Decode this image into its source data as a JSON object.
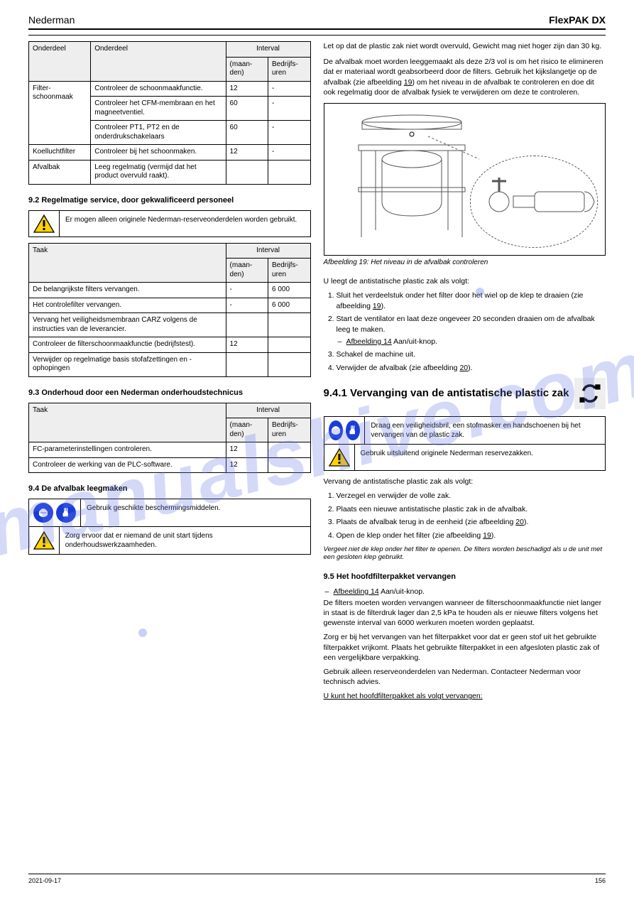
{
  "header": {
    "left": "Nederman",
    "right": "FlexPAK DX"
  },
  "tables": {
    "t1": {
      "head": [
        "Onderdeel",
        "Onderdeel",
        "Interval",
        "IntervalH"
      ],
      "subhead_a": "(maan-den)",
      "subhead_b": "Bedrijfs-uren",
      "rows": [
        [
          "Filter-schoonmaak",
          "Controleer de schoonmaakfunctie.",
          "12",
          "-"
        ],
        [
          "",
          "Controleer het CFM-membraan en het magneetventiel.",
          "60",
          "-"
        ],
        [
          "",
          "Controleer PT1, PT2 en de onderdrukschakelaars",
          "60",
          "-"
        ],
        [
          "Koelluchtfilter",
          "Controleer bij het schoonmaken.",
          "12",
          "-"
        ],
        [
          "Afvalbak",
          "Leeg regelmatig (vermijd dat het product overvuld raakt).",
          "",
          ""
        ]
      ]
    },
    "t2": {
      "head_task": "Taak",
      "head_int": "Interval",
      "sub_a": "(maan-den)",
      "sub_b": "Bedrijfs-uren",
      "rows": [
        [
          "De belangrijkste filters vervangen.",
          "-",
          "6 000"
        ],
        [
          "Het controlefilter vervangen.",
          "-",
          "6 000"
        ],
        [
          "Vervang het veiligheidsmembraan CARZ volgens de instructies van de leverancier.",
          "",
          ""
        ],
        [
          "Controleer de filterschoonmaakfunctie (bedrijfstest).",
          "12",
          ""
        ],
        [
          "Verwijder op regelmatige basis stofafzettingen en - ophopingen",
          "",
          ""
        ]
      ]
    },
    "t3": {
      "head_task": "Taak",
      "head_int": "Interval",
      "sub_a": "(maan-den)",
      "sub_b": "Bedrijfs-uren",
      "rows": [
        [
          "FC-parameterinstellingen controleren.",
          "12",
          ""
        ],
        [
          "Controleer de werking van de PLC-software.",
          "12",
          ""
        ]
      ]
    }
  },
  "sections": {
    "s92": "9.2 Regelmatige service, door gekwalificeerd personeel",
    "s92_warn": "Er mogen alleen originele Nederman-reserveonderdelen worden gebruikt.",
    "s93": "9.3 Onderhoud door een Nederman onderhoudstechnicus",
    "s94": "9.4 De afvalbak leegmaken",
    "s94_ppe": "Gebruik geschikte beschermingsmiddelen.",
    "s94_warn": "Zorg ervoor dat er niemand de unit start tijdens onderhoudswerkzaamheden.",
    "s94_warn2": "Let op dat de plastic zak niet wordt overvuld, Gewicht mag niet hoger zijn dan 30 kg.",
    "s94_text": "De afvalbak moet worden leeggemaakt als deze 2/3 vol is om het risico te elimineren dat er materiaal wordt geabsorbeerd door de filters. Gebruik het kijkslangetje op de afvalbak (zie afbeelding",
    "s94_text_fig": "19",
    "s94_text_tail": ") om het niveau in de afvalbak te controleren en doe dit ook regelmatig door de afvalbak fysiek te verwijderen om deze te controleren.",
    "fig19": "Afbeelding 19: Het niveau in de afvalbak controleren",
    "emptybag_lead": "U leegt de antistatische plastic zak als volgt:",
    "emptybag_steps": {
      "s1a": "Sluit het verdeelstuk onder het filter door het wiel op de klep te draaien (zie afbeelding",
      "s1_fig": "19",
      "s1b": ").",
      "s2a": "Start de ventilator en laat deze ongeveer 20 seconden draaien om de afvalbak leeg te maken.",
      "s2_link": "Afbeelding 14",
      "s2b": "Aan/uit-knop.",
      "s3": "Schakel de machine uit.",
      "s4a": "Verwijder de afvalbak (zie afbeelding",
      "s4_fig": "20",
      "s4b": ")."
    },
    "s941": "9.4.1 Vervanging van de antistatische plastic zak",
    "s941_ppe": "Draag een veiligheidsbril, een stofmasker en handschoenen bij het vervangen van de plastic zak.",
    "s941_warn": "Gebruik uitsluitend originele Nederman reservezakken.",
    "s941_text": "Vervang de antistatische plastic zak als volgt:",
    "s941_steps": {
      "s1": "Verzegel en verwijder de volle zak.",
      "s2": "Plaats een nieuwe antistatische plastic zak in de afvalbak.",
      "s3a": "Plaats de afvalbak terug in de eenheid (zie afbeelding",
      "s3_fig": "20",
      "s3b": ").",
      "s4a": "Open de klep onder het filter (zie afbeelding",
      "s4_fig": "19",
      "s4b": ")."
    },
    "s941_note": "Vergeet niet de klep onder het filter te openen. De filters worden beschadigd als u de unit met een gesloten klep gebruikt.",
    "s95": "9.5 Het hoofdfilterpakket vervangen",
    "s95_text_a": "Afbeelding 14",
    "s95_text_b": "Aan/uit-knop.",
    "s95_p1": "De filters moeten worden vervangen wanneer de filterschoonmaakfunctie niet langer in staat is de filterdruk lager dan 2,5 kPa te houden als er nieuwe filters volgens het gewenste interval van 6000 werkuren moeten worden geplaatst.",
    "s95_p2": "Zorg er bij het vervangen van het filterpakket voor dat er geen stof uit het gebruikte filterpakket vrijkomt. Plaats het gebruikte filterpakket in een afgesloten plastic zak of een vergelijkbare verpakking.",
    "s95_p3": "Gebruik alleen reserveonderdelen van Nederman. Contacteer Nederman voor technisch advies.",
    "s95_proc": "U kunt het hoofdfilterpakket als volgt vervangen:"
  },
  "footer": {
    "left": "2021-09-17",
    "right": "156"
  }
}
